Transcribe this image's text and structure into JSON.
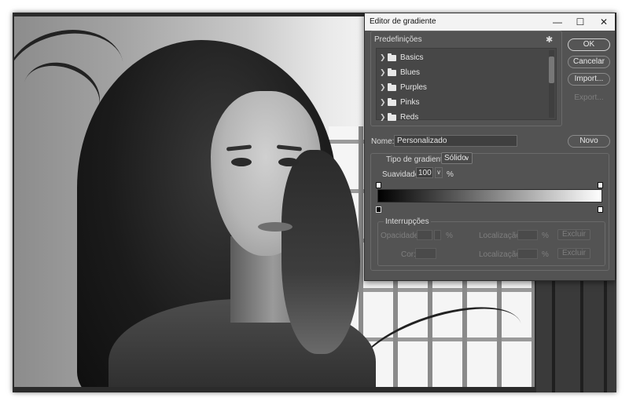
{
  "dialog": {
    "title": "Editor de gradiente",
    "window_controls": {
      "minimize": "—",
      "maximize": "☐",
      "close": "✕"
    },
    "presets": {
      "label": "Predefinições",
      "items": [
        {
          "label": "Basics"
        },
        {
          "label": "Blues"
        },
        {
          "label": "Purples"
        },
        {
          "label": "Pinks"
        },
        {
          "label": "Reds"
        }
      ]
    },
    "buttons": {
      "ok": "OK",
      "cancel": "Cancelar",
      "import": "Import...",
      "export": "Export...",
      "new": "Novo"
    },
    "name": {
      "label": "Nome:",
      "value": "Personalizado"
    },
    "gradient": {
      "type_label": "Tipo de gradiente:",
      "type_value": "Sólido",
      "smoothness_label": "Suavidade:",
      "smoothness_value": "100",
      "smoothness_unit": "%",
      "ramp_colors": [
        "#000000",
        "#ffffff"
      ]
    },
    "stops": {
      "label": "Interrupções",
      "opacity_label": "Opacidade:",
      "percent": "%",
      "location_label": "Localização:",
      "color_label": "Cor:",
      "delete_label": "Excluir"
    }
  }
}
